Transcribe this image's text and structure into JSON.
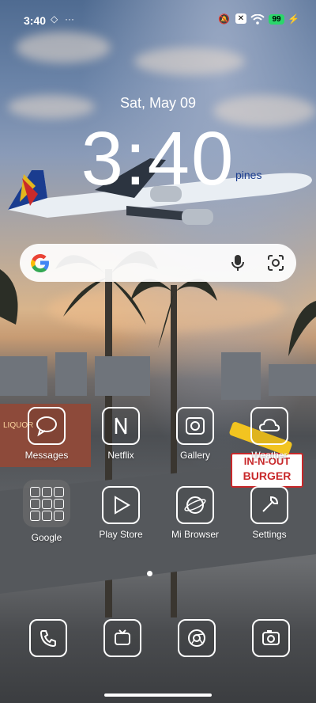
{
  "status_bar": {
    "time": "3:40",
    "battery": "99",
    "icons": [
      "settings-diamond-icon",
      "more-dots-icon",
      "mute-icon",
      "close-box-icon",
      "wifi-icon",
      "battery-icon",
      "charging-bolt-icon"
    ]
  },
  "lock_clock": {
    "date": "Sat, May 09",
    "time": "3:40"
  },
  "wallpaper": {
    "airline_text": "pines",
    "sign_text": [
      "IN-N-OUT",
      "BURGER"
    ],
    "shop_text": "LIQUOR"
  },
  "search": {
    "icons": [
      "google-logo-icon",
      "mic-icon",
      "lens-icon"
    ]
  },
  "apps": [
    {
      "label": "Messages",
      "icon": "messages-icon"
    },
    {
      "label": "Netflix",
      "icon": "netflix-icon"
    },
    {
      "label": "Gallery",
      "icon": "gallery-icon"
    },
    {
      "label": "Weather",
      "icon": "weather-icon"
    },
    {
      "label": "Google",
      "icon": "google-folder-icon"
    },
    {
      "label": "Play Store",
      "icon": "play-store-icon"
    },
    {
      "label": "Mi Browser",
      "icon": "browser-icon"
    },
    {
      "label": "Settings",
      "icon": "settings-icon"
    }
  ],
  "dock": [
    {
      "icon": "phone-icon"
    },
    {
      "icon": "tv-icon"
    },
    {
      "icon": "chrome-icon"
    },
    {
      "icon": "camera-icon"
    }
  ],
  "colors": {
    "accent": "#ffffff",
    "battery": "#2bd66b",
    "sign_red": "#c8282a",
    "sign_yellow": "#f2c420"
  }
}
